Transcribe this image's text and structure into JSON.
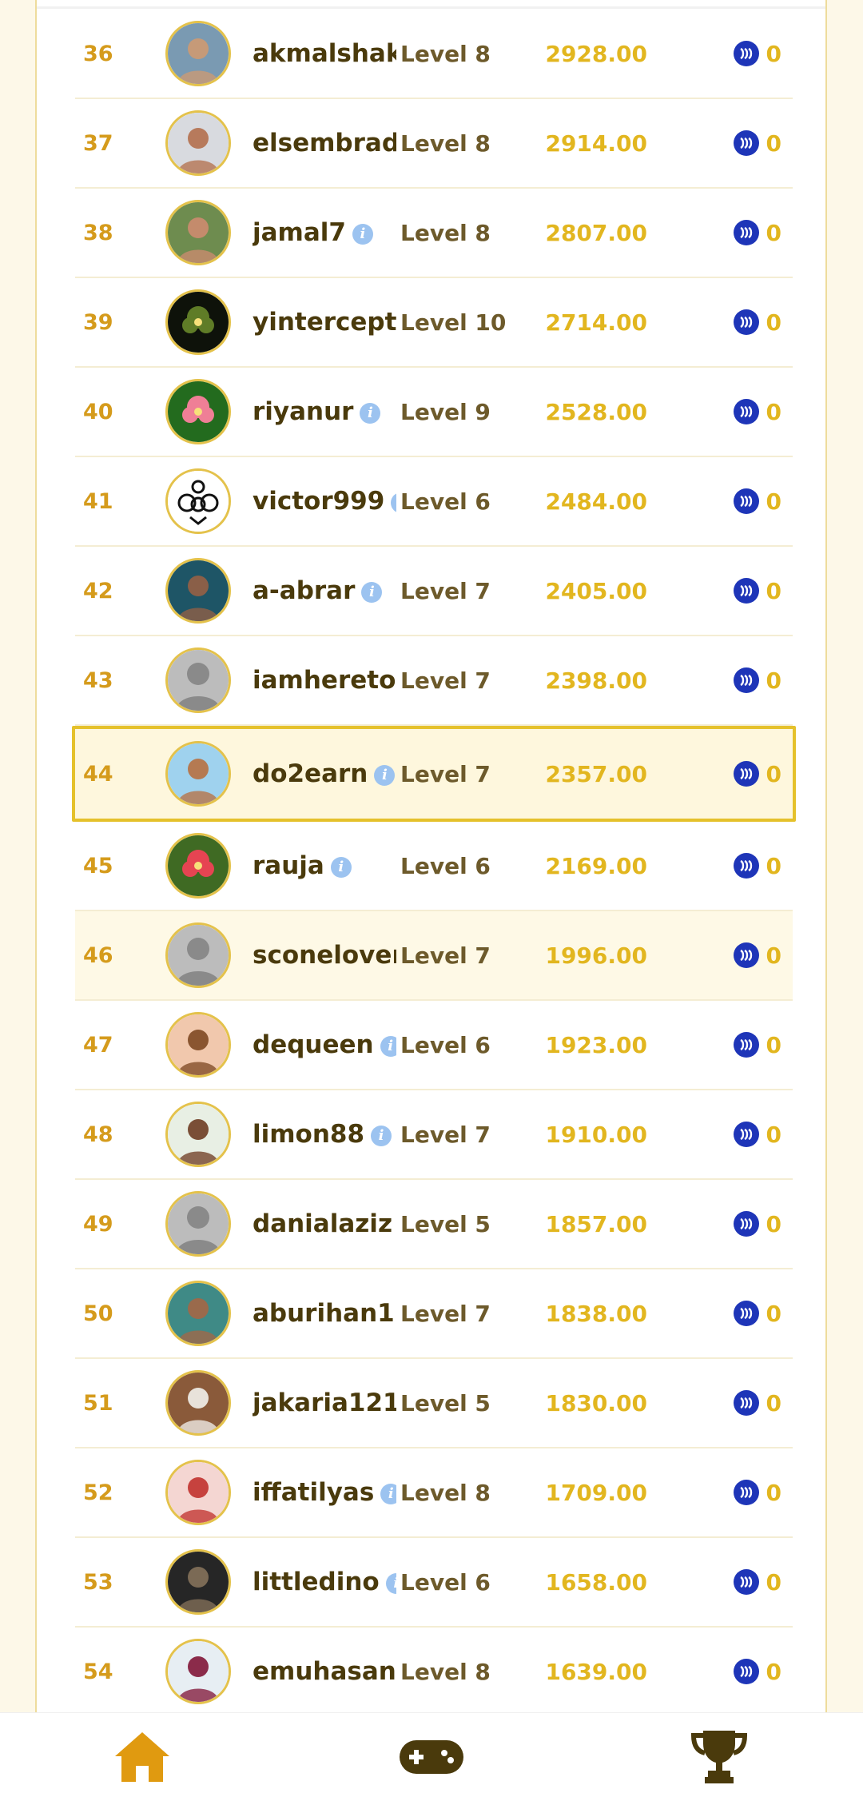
{
  "leaderboard": [
    {
      "rank": "36",
      "name": "akmalshaki",
      "info": false,
      "level": "Level 8",
      "points": "2928.00",
      "reward": "0",
      "avatar": {
        "kind": "photo",
        "bg": "#7a9ab2",
        "fg": "#c69a78"
      }
    },
    {
      "rank": "37",
      "name": "elsembrado",
      "info": false,
      "level": "Level 8",
      "points": "2914.00",
      "reward": "0",
      "avatar": {
        "kind": "photo",
        "bg": "#d8dadf",
        "fg": "#b77a5c"
      }
    },
    {
      "rank": "38",
      "name": "jamal7",
      "info": true,
      "level": "Level 8",
      "points": "2807.00",
      "reward": "0",
      "avatar": {
        "kind": "photo",
        "bg": "#6e8c4f",
        "fg": "#c48b6c"
      }
    },
    {
      "rank": "39",
      "name": "yintercept",
      "info": true,
      "level": "Level 10",
      "points": "2714.00",
      "reward": "0",
      "avatar": {
        "kind": "flower",
        "bg": "#0e120a",
        "fg": "#5f7c27"
      }
    },
    {
      "rank": "40",
      "name": "riyanur",
      "info": true,
      "level": "Level 9",
      "points": "2528.00",
      "reward": "0",
      "avatar": {
        "kind": "flower",
        "bg": "#236b1e",
        "fg": "#ef7f96"
      }
    },
    {
      "rank": "41",
      "name": "victor999",
      "info": true,
      "level": "Level 6",
      "points": "2484.00",
      "reward": "0",
      "avatar": {
        "kind": "logo",
        "bg": "#ffffff",
        "fg": "#111111"
      }
    },
    {
      "rank": "42",
      "name": "a-abrar",
      "info": true,
      "level": "Level 7",
      "points": "2405.00",
      "reward": "0",
      "avatar": {
        "kind": "photo",
        "bg": "#1e5566",
        "fg": "#8a5f48"
      }
    },
    {
      "rank": "43",
      "name": "iamheretoo",
      "info": false,
      "level": "Level 7",
      "points": "2398.00",
      "reward": "0",
      "avatar": {
        "kind": "default",
        "bg": "#bcbcbc",
        "fg": "#8a8a8a"
      }
    },
    {
      "rank": "44",
      "name": "do2earn",
      "info": true,
      "level": "Level 7",
      "points": "2357.00",
      "reward": "0",
      "avatar": {
        "kind": "photo",
        "bg": "#9fd2ee",
        "fg": "#b57a52"
      },
      "highlight": true
    },
    {
      "rank": "45",
      "name": "rauja",
      "info": true,
      "level": "Level 6",
      "points": "2169.00",
      "reward": "0",
      "avatar": {
        "kind": "flower",
        "bg": "#3f6a23",
        "fg": "#e64452"
      }
    },
    {
      "rank": "46",
      "name": "sconelover",
      "info": false,
      "level": "Level 7",
      "points": "1996.00",
      "reward": "0",
      "avatar": {
        "kind": "default",
        "bg": "#bcbcbc",
        "fg": "#8a8a8a"
      },
      "alt": true
    },
    {
      "rank": "47",
      "name": "dequeen",
      "info": true,
      "level": "Level 6",
      "points": "1923.00",
      "reward": "0",
      "avatar": {
        "kind": "photo",
        "bg": "#f1c8ad",
        "fg": "#8a5530"
      }
    },
    {
      "rank": "48",
      "name": "limon88",
      "info": true,
      "level": "Level 7",
      "points": "1910.00",
      "reward": "0",
      "avatar": {
        "kind": "photo",
        "bg": "#e8efe4",
        "fg": "#7a4e36"
      }
    },
    {
      "rank": "49",
      "name": "danialaziz",
      "info": true,
      "level": "Level 5",
      "points": "1857.00",
      "reward": "0",
      "avatar": {
        "kind": "default",
        "bg": "#bcbcbc",
        "fg": "#8a8a8a"
      }
    },
    {
      "rank": "50",
      "name": "aburihan1",
      "info": true,
      "level": "Level 7",
      "points": "1838.00",
      "reward": "0",
      "avatar": {
        "kind": "photo",
        "bg": "#3f8a86",
        "fg": "#9a6a4c"
      }
    },
    {
      "rank": "51",
      "name": "jakaria121",
      "info": true,
      "level": "Level 5",
      "points": "1830.00",
      "reward": "0",
      "avatar": {
        "kind": "photo",
        "bg": "#8a5a3a",
        "fg": "#e8e2da"
      }
    },
    {
      "rank": "52",
      "name": "iffatilyas",
      "info": true,
      "level": "Level 8",
      "points": "1709.00",
      "reward": "0",
      "avatar": {
        "kind": "photo",
        "bg": "#f4d6d2",
        "fg": "#c6423e"
      }
    },
    {
      "rank": "53",
      "name": "littledino",
      "info": true,
      "level": "Level 6",
      "points": "1658.00",
      "reward": "0",
      "avatar": {
        "kind": "photo",
        "bg": "#262626",
        "fg": "#7b6a55"
      }
    },
    {
      "rank": "54",
      "name": "emuhasan",
      "info": true,
      "level": "Level 8",
      "points": "1639.00",
      "reward": "0",
      "avatar": {
        "kind": "photo",
        "bg": "#e7eef3",
        "fg": "#8b2b4a"
      }
    }
  ],
  "nav": {
    "home_icon": "home-icon",
    "games_icon": "gamepad-icon",
    "leaderboard_icon": "trophy-icon",
    "colors": {
      "home": "#e09a10",
      "games": "#4a3a0c",
      "leaderboard": "#4a3a0c"
    }
  },
  "colors": {
    "rank": "#d59b1c",
    "points": "#e2b61f",
    "name": "#4a3a0c",
    "level": "#6d5a2b",
    "steem": "#1e35b8",
    "highlight_border": "#e5c12b"
  }
}
